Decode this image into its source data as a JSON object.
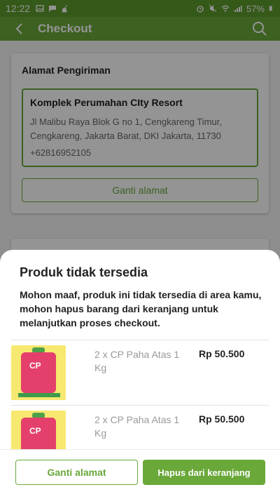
{
  "status_bar": {
    "time": "12:22",
    "battery": "57%"
  },
  "app_bar": {
    "title": "Checkout"
  },
  "address_card": {
    "title": "Alamat Pengiriman",
    "name": "Komplek Perumahan CIty Resort",
    "line1": "Jl Malibu Raya Blok G no 1, Cengkareng Timur,",
    "line2": "Cengkareng, Jakarta Barat, DKI Jakarta,  11730",
    "phone": "+62816952105",
    "change_button": "Ganti alamat"
  },
  "sheet": {
    "title": "Produk tidak tersedia",
    "message": "Mohon maaf, produk ini tidak tersedia di area kamu, mohon hapus barang dari keranjang untuk melanjutkan proses checkout.",
    "products": [
      {
        "name": "2 x CP Paha Atas 1 Kg",
        "price": "Rp 50.500",
        "pack_label": "CP"
      },
      {
        "name": "2 x CP Paha Atas 1 Kg",
        "price": "Rp 50.500",
        "pack_label": "CP"
      }
    ],
    "change_address_button": "Ganti alamat",
    "remove_button": "Hapus dari keranjang"
  },
  "colors": {
    "primary_green": "#6aa83a",
    "status_green": "#5c9a2c"
  }
}
